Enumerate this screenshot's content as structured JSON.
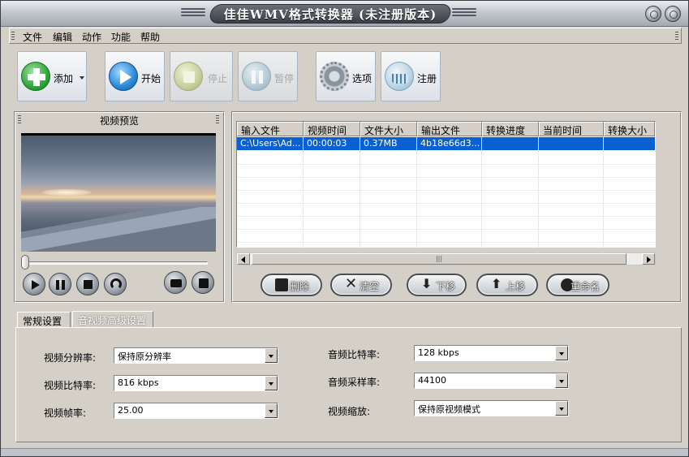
{
  "window": {
    "title": "佳佳WMV格式转换器  (未注册版本)"
  },
  "menu": [
    "文件",
    "编辑",
    "动作",
    "功能",
    "帮助"
  ],
  "toolbar": {
    "add": "添加",
    "start": "开始",
    "stop": "停止",
    "pause": "暂停",
    "options": "选项",
    "register": "注册"
  },
  "preview": {
    "title": "视频预览",
    "slider_position": 0
  },
  "file_list": {
    "columns": [
      "输入文件",
      "视频时间",
      "文件大小",
      "输出文件",
      "转换进度",
      "当前时间",
      "转换大小"
    ],
    "rows": [
      [
        "C:\\Users\\Ad...",
        "00:00:03",
        "0.37MB",
        "4b18e66d3...",
        "",
        "",
        ""
      ]
    ]
  },
  "list_buttons": {
    "delete": "删除",
    "clear": "清空",
    "down": "下移",
    "up": "上移",
    "rename": "重命名"
  },
  "tabs": [
    "常规设置",
    "音视频高级设置"
  ],
  "settings": {
    "video_resolution": {
      "label": "视频分辨率:",
      "value": "保持原分辨率"
    },
    "video_bitrate": {
      "label": "视频比特率:",
      "value": "816 kbps"
    },
    "video_framerate": {
      "label": "视频帧率:",
      "value": "25.00"
    },
    "audio_bitrate": {
      "label": "音频比特率:",
      "value": "128 kbps"
    },
    "audio_samplerate": {
      "label": "音频采样率:",
      "value": "44100"
    },
    "video_scale": {
      "label": "视频缩放:",
      "value": "保持原视频模式"
    }
  },
  "colors": {
    "selection": "#0a5fd1",
    "face": "#d4d0c8"
  }
}
